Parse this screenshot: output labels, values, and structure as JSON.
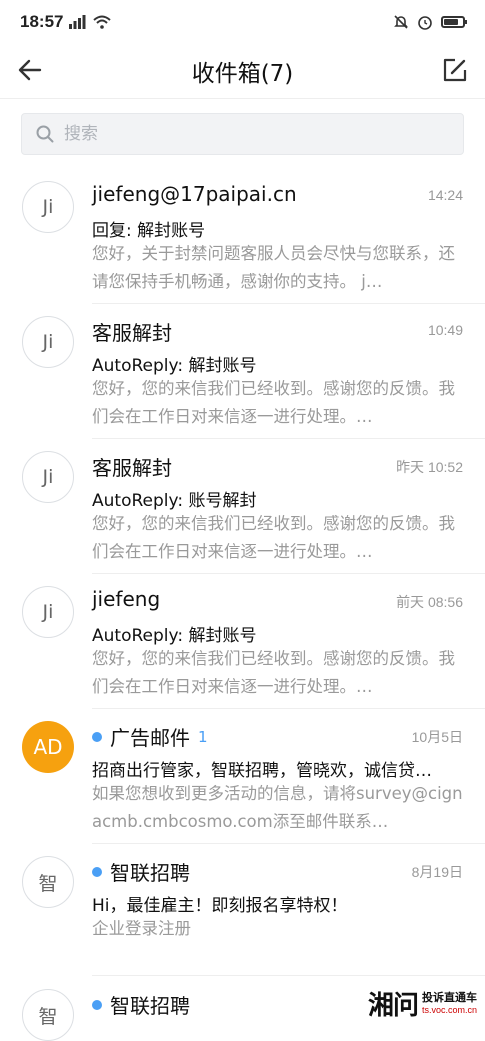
{
  "status_bar": {
    "time": "18:57"
  },
  "nav": {
    "title": "收件箱(7)"
  },
  "search": {
    "placeholder": "搜索"
  },
  "mails": [
    {
      "avatar": "Ji",
      "sender": "jiefeng@17paipai.cn",
      "time": "14:24",
      "subject": "回复: 解封账号",
      "preview": "您好，关于封禁问题客服人员会尽快与您联系，还请您保持手机畅通，感谢你的支持。 j…"
    },
    {
      "avatar": "Ji",
      "sender": "客服解封",
      "time": "10:49",
      "subject": "AutoReply: 解封账号",
      "preview": "您好，您的来信我们已经收到。感谢您的反馈。我们会在工作日对来信逐一进行处理。…"
    },
    {
      "avatar": "Ji",
      "sender": "客服解封",
      "time": "昨天 10:52",
      "subject": "AutoReply: 账号解封",
      "preview": "您好，您的来信我们已经收到。感谢您的反馈。我们会在工作日对来信逐一进行处理。…"
    },
    {
      "avatar": "Ji",
      "sender": "jiefeng",
      "time": "前天 08:56",
      "subject": "AutoReply: 解封账号",
      "preview": "您好，您的来信我们已经收到。感谢您的反馈。我们会在工作日对来信逐一进行处理。…"
    },
    {
      "avatar": "AD",
      "sender": "广告邮件",
      "count": "1",
      "time": "10月5日",
      "subject": "招商出行管家，智联招聘，管晓欢，诚信贷…",
      "preview": "如果您想收到更多活动的信息，请将survey@cignacmb.cmbcosmo.com添至邮件联系…"
    },
    {
      "avatar": "智",
      "sender": "智联招聘",
      "time": "8月19日",
      "subject": "Hi，最佳雇主！即刻报名享特权！",
      "preview": "企业登录注册"
    },
    {
      "avatar": "智",
      "sender": "智联招聘"
    }
  ],
  "watermark": {
    "logo": "湘问",
    "slogan": "投诉直通车",
    "url": "ts.voc.com.cn"
  },
  "colors": {
    "accent": "#4a9ff5",
    "avatar_orange": "#f6a10f",
    "muted_text": "#9a9a9a"
  }
}
